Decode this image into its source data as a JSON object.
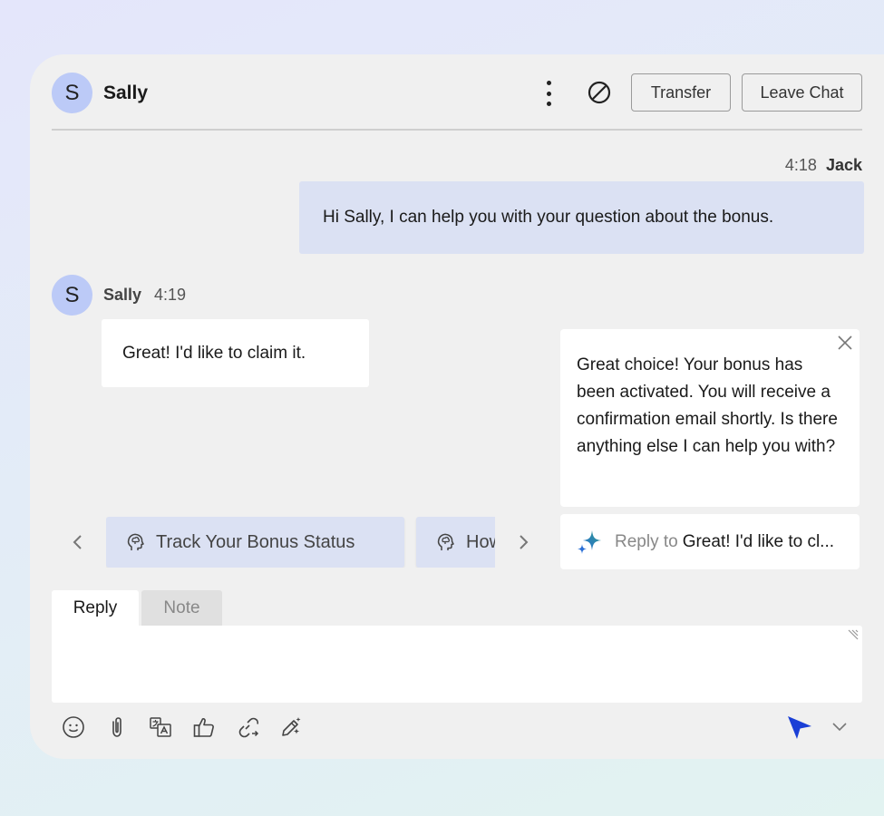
{
  "header": {
    "avatar_initial": "S",
    "contact_name": "Sally",
    "transfer_label": "Transfer",
    "leave_chat_label": "Leave Chat"
  },
  "messages": [
    {
      "direction": "outgoing",
      "time": "4:18",
      "author": "Jack",
      "text": "Hi Sally, I can help you with your question about the bonus."
    },
    {
      "direction": "incoming",
      "avatar_initial": "S",
      "author": "Sally",
      "time": "4:19",
      "text": "Great! I'd like to claim it."
    }
  ],
  "ai_suggestion": {
    "text": "Great choice! Your bonus has been activated. You will receive a confirmation email shortly. Is there anything else I can help you with?",
    "reply_to_label": "Reply to",
    "reply_to_quote": "Great! I'd like to cl...",
    "icon": "sparkle-icon"
  },
  "suggestion_chips": [
    {
      "label": "Track Your Bonus Status",
      "icon": "brain-icon"
    },
    {
      "label": "How",
      "icon": "brain-icon"
    }
  ],
  "composer": {
    "tabs": [
      "Reply",
      "Note"
    ],
    "active_tab": "Reply",
    "toolbar_icons": [
      "emoji-icon",
      "attachment-icon",
      "translate-icon",
      "thumbs-up-icon",
      "link-icon",
      "magic-pen-icon"
    ]
  },
  "colors": {
    "accent": "#1a3fd6",
    "avatar_bg": "#bccaf7",
    "bubble_out_bg": "#dbe1f3",
    "panel_bg": "#f0f0f0"
  }
}
